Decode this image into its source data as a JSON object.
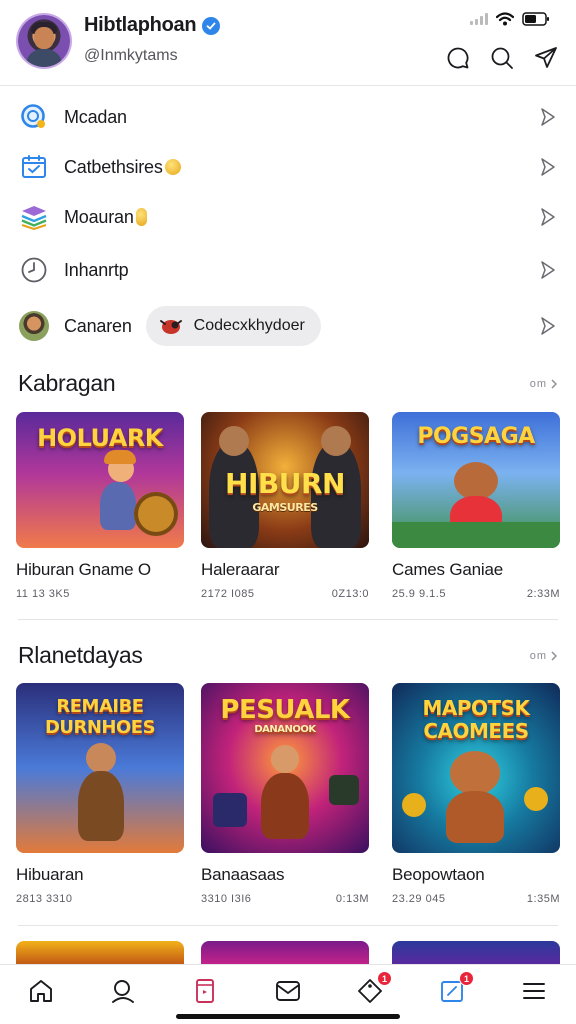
{
  "header": {
    "username": "Hibtlaphoan",
    "handle": "@Inmkytams",
    "verified": true
  },
  "menu": {
    "items": [
      {
        "label": "Mcadan",
        "icon": "search-badge-icon"
      },
      {
        "label": "Catbethsires",
        "icon": "calendar-icon"
      },
      {
        "label": "Moauran",
        "icon": "stack-icon"
      },
      {
        "label": "Inhanrtp",
        "icon": "clock-icon"
      },
      {
        "label": "Canaren",
        "icon": "avatar",
        "chip": "Codecxkhydoer"
      }
    ]
  },
  "section1": {
    "title": "Kabragan",
    "see_all": "om",
    "cards": [
      {
        "logo": "HOLUARK",
        "title": "Hiburan Gname O",
        "meta_left": "11 13 3K5",
        "meta_right": ""
      },
      {
        "logo": "HIBURN",
        "sub": "GAMSURES",
        "title": "Haleraarar",
        "meta_left": "2172 I085",
        "meta_right": "0Z13:0"
      },
      {
        "logo": "POGSAGA",
        "title": "Cames Ganiae",
        "meta_left": "25.9 9.1.5",
        "meta_right": "2:33M"
      }
    ]
  },
  "section2": {
    "title": "Rlanetdayas",
    "see_all": "om",
    "cards": [
      {
        "logo": "REMAIBE DURNHOES",
        "title": "Hibuaran",
        "meta_left": "2813 3310",
        "meta_right": ""
      },
      {
        "logo": "PESUALK",
        "sub": "DANANOOK",
        "title": "Banaasaas",
        "meta_left": "3310 I3I6",
        "meta_right": "0:13M"
      },
      {
        "logo": "MAPOTSK CAOMEES",
        "title": "Beopowtaon",
        "meta_left": "23.29 045",
        "meta_right": "1:35M"
      }
    ]
  },
  "bottom_nav": {
    "items": [
      {
        "name": "home"
      },
      {
        "name": "search"
      },
      {
        "name": "library"
      },
      {
        "name": "inbox"
      },
      {
        "name": "tag",
        "badge": "1"
      },
      {
        "name": "notes",
        "badge": "1"
      },
      {
        "name": "menu"
      }
    ]
  },
  "colors": {
    "accent_blue": "#2f86ea",
    "badge_red": "#e8253a",
    "text": "#1b1b1f",
    "muted": "#5d5d66"
  }
}
